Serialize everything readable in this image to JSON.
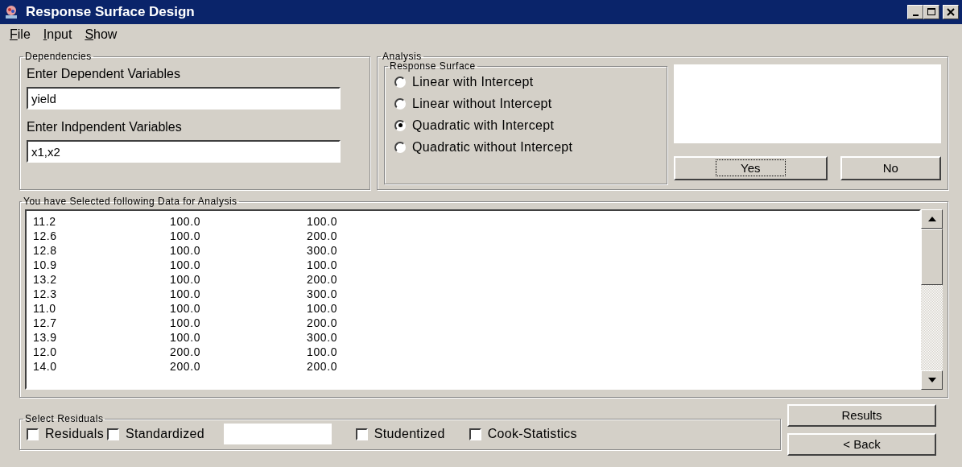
{
  "window": {
    "title": "Response Surface Design"
  },
  "menu": [
    "File",
    "Input",
    "Show"
  ],
  "dependencies": {
    "title": "Dependencies",
    "fields": [
      {
        "label": "Enter Dependent Variables",
        "value": "yield"
      },
      {
        "label": "Enter Indpendent Variables",
        "value": "x1,x2"
      }
    ]
  },
  "analysis": {
    "title": "Analysis",
    "group_title": "Response Surface",
    "options": [
      {
        "label": "Linear with Intercept",
        "selected": false
      },
      {
        "label": "Linear without Intercept",
        "selected": false
      },
      {
        "label": "Quadratic with Intercept",
        "selected": true
      },
      {
        "label": "Quadratic without Intercept",
        "selected": false
      }
    ],
    "buttons": [
      {
        "label": "Yes",
        "focused": true
      },
      {
        "label": "No",
        "focused": false
      }
    ]
  },
  "data": {
    "title": "You have Selected following Data for Analysis",
    "rows": [
      [
        "11.2",
        "100.0",
        "100.0"
      ],
      [
        "12.6",
        "100.0",
        "200.0"
      ],
      [
        "12.8",
        "100.0",
        "300.0"
      ],
      [
        "10.9",
        "100.0",
        "100.0"
      ],
      [
        "13.2",
        "100.0",
        "200.0"
      ],
      [
        "12.3",
        "100.0",
        "300.0"
      ],
      [
        "11.0",
        "100.0",
        "100.0"
      ],
      [
        "12.7",
        "100.0",
        "200.0"
      ],
      [
        "13.9",
        "100.0",
        "300.0"
      ],
      [
        "12.0",
        "200.0",
        "100.0"
      ],
      [
        "14.0",
        "200.0",
        "200.0"
      ]
    ]
  },
  "residuals": {
    "title": "Select Residuals",
    "items": [
      {
        "kind": "checkbox",
        "label": "Residuals",
        "checked": false
      },
      {
        "kind": "checkbox",
        "label": "Standardized",
        "checked": false
      },
      {
        "kind": "field"
      },
      {
        "kind": "checkbox",
        "label": "Studentized",
        "checked": false
      },
      {
        "kind": "checkbox",
        "label": "Cook-Statistics",
        "checked": false
      }
    ]
  },
  "buttons": [
    "Results",
    "< Back"
  ]
}
